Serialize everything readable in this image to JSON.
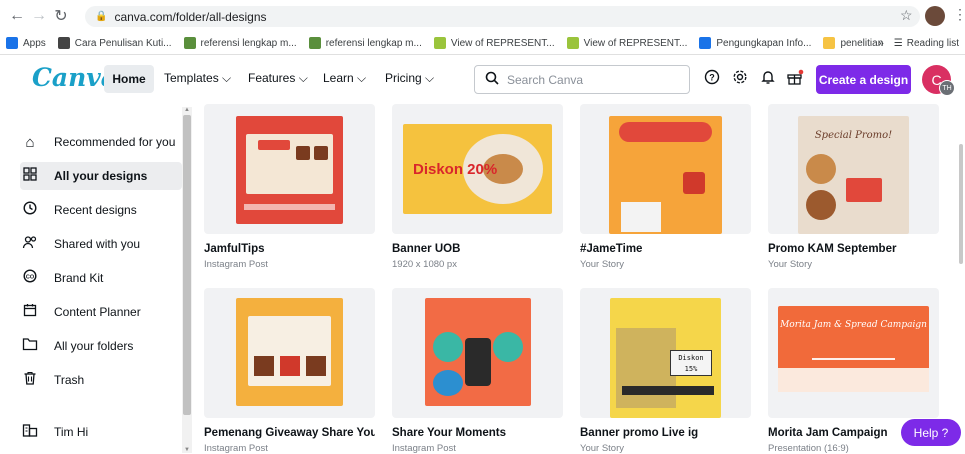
{
  "browser": {
    "url": "canva.com/folder/all-designs",
    "bookmarks": [
      {
        "label": "Apps",
        "color": "#1a73e8"
      },
      {
        "label": "Cara Penulisan Kuti...",
        "color": "#444444"
      },
      {
        "label": "referensi lengkap m...",
        "color": "#5a8f3c"
      },
      {
        "label": "referensi lengkap m...",
        "color": "#5a8f3c"
      },
      {
        "label": "View of REPRESENT...",
        "color": "#9ac43c"
      },
      {
        "label": "View of REPRESENT...",
        "color": "#9ac43c"
      },
      {
        "label": "Pengungkapan Info...",
        "color": "#1a73e8"
      },
      {
        "label": "penelitian",
        "color": "#f6c343"
      }
    ],
    "overflow": "»",
    "reading_list": "Reading list"
  },
  "header": {
    "logo": "Canva",
    "home": "Home",
    "nav": [
      "Templates ⌵",
      "Features ⌵",
      "Learn ⌵",
      "Pricing ⌵"
    ],
    "search_placeholder": "Search Canva",
    "create": "Create a design",
    "avatar_letter": "C",
    "avatar_sub": "TH"
  },
  "sidebar": {
    "items": [
      {
        "label": "Recommended for you",
        "icon": "home-icon"
      },
      {
        "label": "All your designs",
        "icon": "grid-icon"
      },
      {
        "label": "Recent designs",
        "icon": "clock-icon"
      },
      {
        "label": "Shared with you",
        "icon": "people-icon"
      },
      {
        "label": "Brand Kit",
        "icon": "brand-kit-icon"
      },
      {
        "label": "Content Planner",
        "icon": "calendar-icon"
      },
      {
        "label": "All your folders",
        "icon": "folder-icon"
      },
      {
        "label": "Trash",
        "icon": "trash-icon"
      },
      {
        "label": "Tim Hi",
        "icon": "team-icon"
      }
    ]
  },
  "designs": [
    {
      "title": "JamfulTips",
      "subtitle": "Instagram Post",
      "bg": "#e1483b"
    },
    {
      "title": "Banner UOB",
      "subtitle": "1920 x 1080 px",
      "bg": "#f5c23e",
      "art_text": "Diskon 20%"
    },
    {
      "title": "#JameTime",
      "subtitle": "Your Story",
      "bg": "#f6a43a"
    },
    {
      "title": "Promo KAM September",
      "subtitle": "Your Story",
      "bg": "#e9dccd",
      "art_text": "Special Promo!"
    },
    {
      "title": "Pemenang Giveaway Share Your ...",
      "subtitle": "Instagram Post",
      "bg": "#f4b03e"
    },
    {
      "title": "Share Your Moments",
      "subtitle": "Instagram Post",
      "bg": "#f26b45"
    },
    {
      "title": "Banner promo Live ig",
      "subtitle": "Your Story",
      "bg": "#f5d64a",
      "art_text": "Diskon 15%"
    },
    {
      "title": "Morita Jam Campaign",
      "subtitle": "Presentation (16:9)",
      "bg": "#f16a3a",
      "art_text": "Morita Jam & Spread Campaign"
    }
  ],
  "help": "Help ?"
}
